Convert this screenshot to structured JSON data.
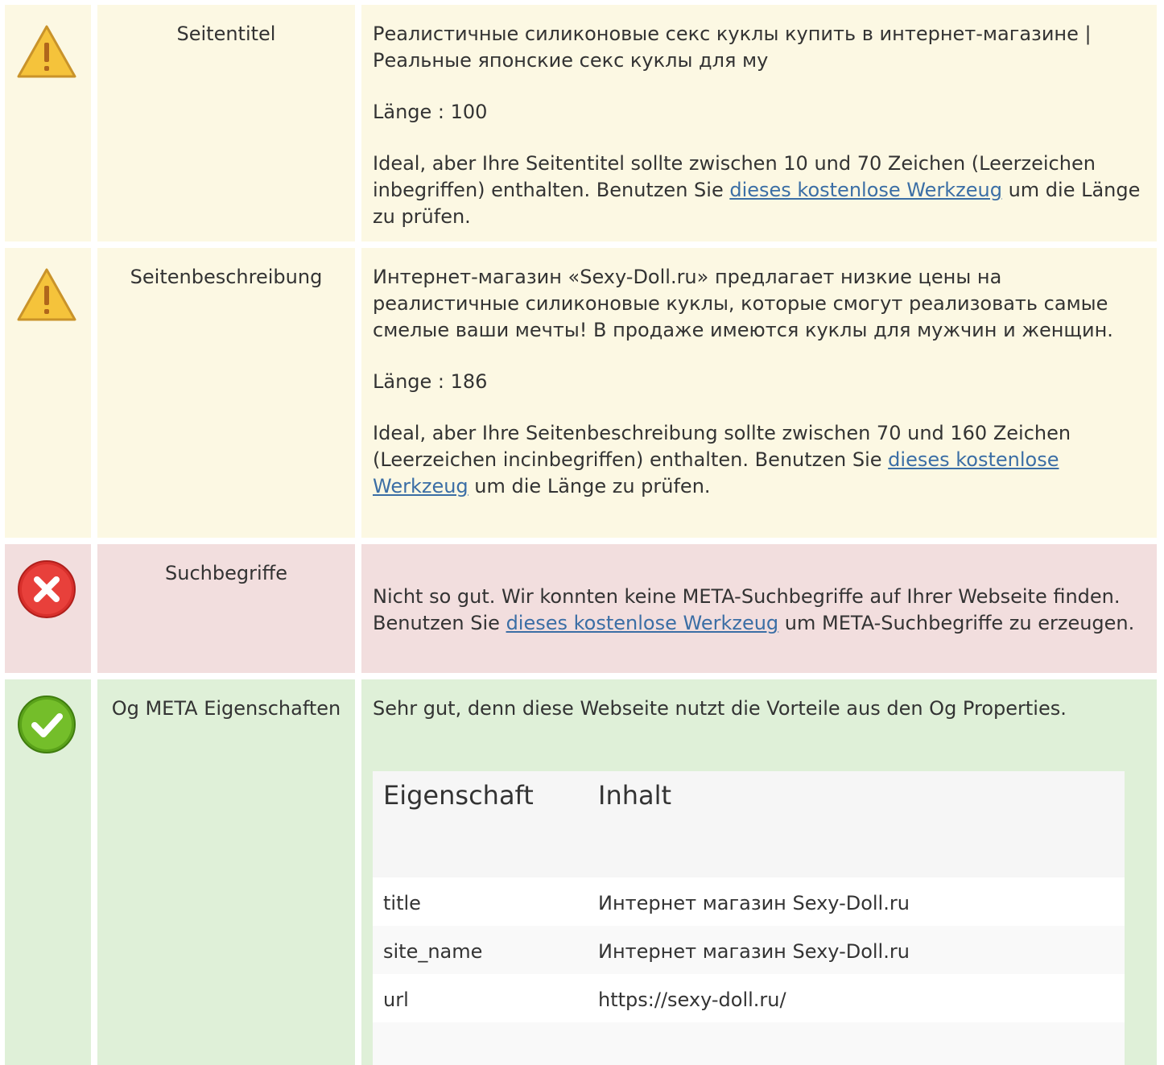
{
  "rows": [
    {
      "status": "warning",
      "label": "Seitentitel",
      "text": "Реалистичные силиконовые секс куклы купить в интернет-магазине | Реальные японские секс куклы для му",
      "length": "Länge : 100",
      "advice_before": "Ideal, aber Ihre Seitentitel sollte zwischen 10 und 70 Zeichen (Leerzeichen inbegriffen) enthalten. Benutzen Sie ",
      "link": "dieses kostenlose Werkzeug",
      "advice_after": " um die Länge zu prüfen."
    },
    {
      "status": "warning",
      "label": "Seitenbeschreibung",
      "text": "Интернет-магазин «Sexy-Doll.ru» предлагает низкие цены на реалистичные силиконовые куклы, которые смогут реализовать самые смелые ваши мечты! В продаже имеются куклы для мужчин и женщин.",
      "length": "Länge : 186",
      "advice_before": "Ideal, aber Ihre Seitenbeschreibung sollte zwischen 70 und 160 Zeichen (Leerzeichen incinbegriffen) enthalten. Benutzen Sie ",
      "link": "dieses kostenlose Werkzeug",
      "advice_after": " um die Länge zu prüfen."
    },
    {
      "status": "error",
      "label": "Suchbegriffe",
      "advice_before": "Nicht so gut. Wir konnten keine META-Suchbegriffe auf Ihrer Webseite finden. Benutzen Sie ",
      "link": "dieses kostenlose Werkzeug",
      "advice_after": " um META-Suchbegriffe zu erzeugen."
    },
    {
      "status": "success",
      "label": "Og META Eigenschaften",
      "text": "Sehr gut, denn diese Webseite nutzt die Vorteile aus den Og Properties.",
      "table": {
        "headers": [
          "Eigenschaft",
          "Inhalt"
        ],
        "rows": [
          [
            "title",
            "Интернет магазин Sexy-Doll.ru"
          ],
          [
            "site_name",
            "Интернет магазин Sexy-Doll.ru"
          ],
          [
            "url",
            "https://sexy-doll.ru/"
          ]
        ]
      }
    }
  ],
  "colors": {
    "warning_bg": "#fcf8e3",
    "error_bg": "#f2dede",
    "success_bg": "#dff0d8",
    "link": "#3b6ea5"
  },
  "icons": [
    "warning-icon",
    "warning-icon",
    "error-icon",
    "success-icon"
  ]
}
